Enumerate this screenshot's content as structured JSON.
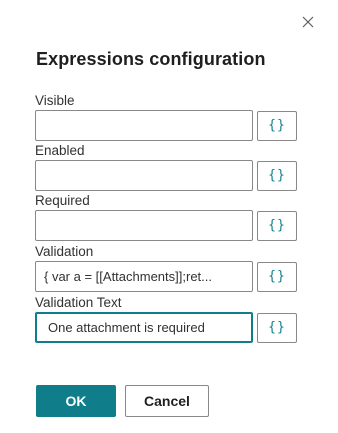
{
  "dialog": {
    "title": "Expressions configuration",
    "close_icon": "close-icon"
  },
  "fields": [
    {
      "label": "Visible",
      "value": "",
      "button_glyph": "{}"
    },
    {
      "label": "Enabled",
      "value": "",
      "button_glyph": "{}"
    },
    {
      "label": "Required",
      "value": "",
      "button_glyph": "{}"
    },
    {
      "label": "Validation",
      "value": "{ var a = [[Attachments]];ret...",
      "button_glyph": "{}"
    },
    {
      "label": "Validation Text",
      "value": "One attachment is required",
      "button_glyph": "{}"
    }
  ],
  "footer": {
    "ok_label": "OK",
    "cancel_label": "Cancel"
  },
  "colors": {
    "accent": "#0f7d8a",
    "border": "#8a8886",
    "text": "#201f1e"
  }
}
